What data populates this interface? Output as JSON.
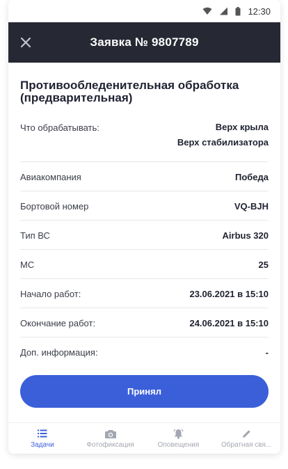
{
  "statusbar": {
    "time": "12:30"
  },
  "header": {
    "title": "Заявка № 9807789"
  },
  "task": {
    "title": "Противообледенительная обработка (предварительная)",
    "rows": [
      {
        "label": "Что обрабатывать:",
        "values": [
          "Верх крыла",
          "Верх стабилизатора"
        ]
      },
      {
        "label": "Авиакомпания",
        "value": "Победа"
      },
      {
        "label": "Бортовой номер",
        "value": "VQ-BJH"
      },
      {
        "label": "Тип ВС",
        "value": "Airbus 320"
      },
      {
        "label": "МС",
        "value": "25"
      },
      {
        "label": "Начало работ:",
        "value": "23.06.2021 в 15:10"
      },
      {
        "label": "Окончание работ:",
        "value": "24.06.2021 в 15:10"
      },
      {
        "label": "Доп. информация:",
        "value": "-"
      }
    ]
  },
  "actions": {
    "accept_label": "Принял"
  },
  "tabbar": {
    "tabs": [
      {
        "label": "Задачи",
        "icon": "list-icon"
      },
      {
        "label": "Фотофиксация",
        "icon": "camera-icon"
      },
      {
        "label": "Оповещения",
        "icon": "bell-icon"
      },
      {
        "label": "Обратная свя...",
        "icon": "pencil-icon"
      }
    ]
  },
  "colors": {
    "header_bg": "#262833",
    "accent": "#3b5fd9",
    "tab_inactive": "#a4a7b1"
  }
}
